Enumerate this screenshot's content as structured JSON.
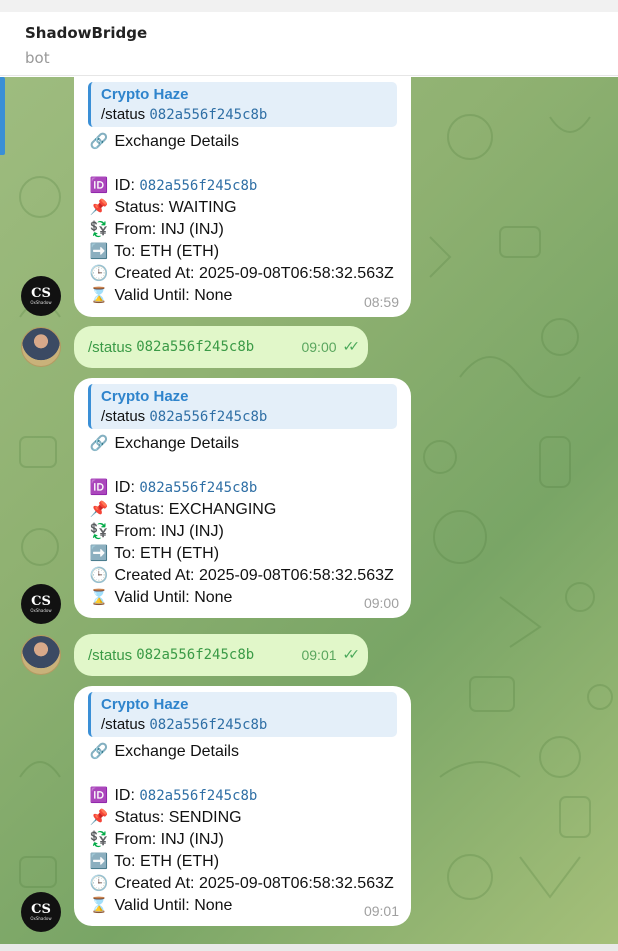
{
  "header": {
    "title": "ShadowBridge",
    "subtitle": "bot"
  },
  "bot_avatar": {
    "logo": "CS",
    "tiny": "OxShadow"
  },
  "emoji": {
    "link": "🔗",
    "id": "🆔",
    "pin": "📌",
    "exchange": "💱",
    "arrow": "➡️",
    "clock": "🕒",
    "hourglass": "⌛"
  },
  "messages": [
    {
      "type": "bot",
      "reply_title": "Crypto Haze",
      "reply_cmd": "/status",
      "reply_code": "082a556f245c8b",
      "heading": "Exchange Details",
      "id_label": "ID:",
      "id_value": "082a556f245c8b",
      "status": "Status: WAITING",
      "from": "From: INJ (INJ)",
      "to": "To: ETH (ETH)",
      "created": "Created At: 2025-09-08T06:58:32.563Z",
      "valid": "Valid Until: None",
      "time": "08:59"
    },
    {
      "type": "user",
      "cmd": "/status",
      "code": "082a556f245c8b",
      "time": "09:00",
      "checks": "✓✓"
    },
    {
      "type": "bot",
      "reply_title": "Crypto Haze",
      "reply_cmd": "/status",
      "reply_code": "082a556f245c8b",
      "heading": "Exchange Details",
      "id_label": "ID:",
      "id_value": "082a556f245c8b",
      "status": "Status: EXCHANGING",
      "from": "From: INJ (INJ)",
      "to": "To: ETH (ETH)",
      "created": "Created At: 2025-09-08T06:58:32.563Z",
      "valid": "Valid Until: None",
      "time": "09:00"
    },
    {
      "type": "user",
      "cmd": "/status",
      "code": "082a556f245c8b",
      "time": "09:01",
      "checks": "✓✓"
    },
    {
      "type": "bot",
      "reply_title": "Crypto Haze",
      "reply_cmd": "/status",
      "reply_code": "082a556f245c8b",
      "heading": "Exchange Details",
      "id_label": "ID:",
      "id_value": "082a556f245c8b",
      "status": "Status: SENDING",
      "from": "From: INJ (INJ)",
      "to": "To: ETH (ETH)",
      "created": "Created At: 2025-09-08T06:58:32.563Z",
      "valid": "Valid Until: None",
      "time": "09:01"
    }
  ]
}
